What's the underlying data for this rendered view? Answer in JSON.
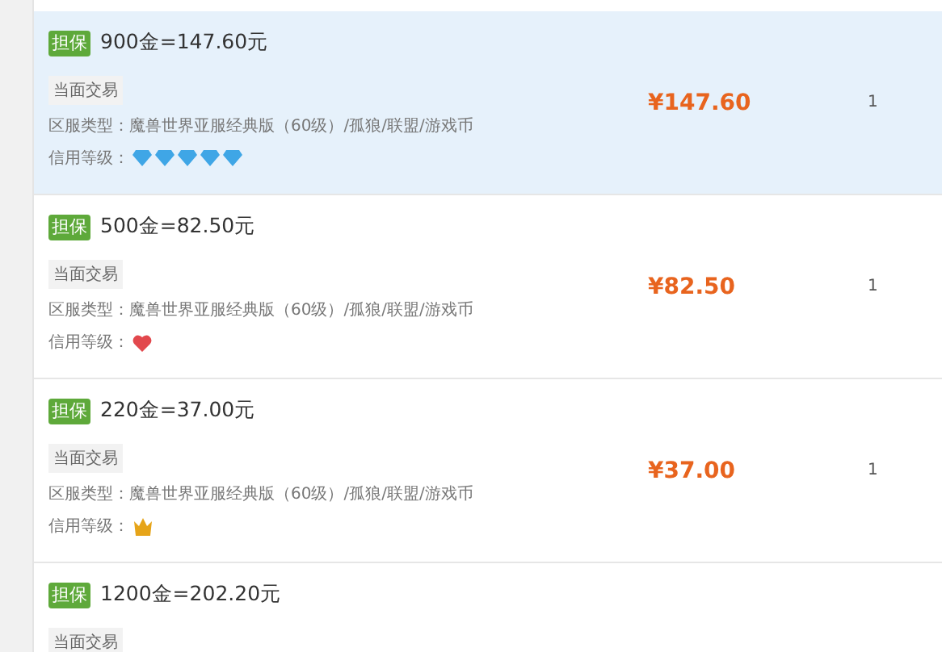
{
  "listings": [
    {
      "badge": "担保",
      "title": "900金=147.60元",
      "selected": true,
      "tag": "当面交易",
      "server": "区服类型：魔兽世界亚服经典版（60级）/孤狼/联盟/游戏币",
      "credit_label": "信用等级：",
      "credit_icons": [
        {
          "kind": "diamond"
        },
        {
          "kind": "diamond"
        },
        {
          "kind": "diamond"
        },
        {
          "kind": "diamond"
        },
        {
          "kind": "diamond"
        }
      ],
      "price": "¥147.60",
      "quantity": "1"
    },
    {
      "badge": "担保",
      "title": "500金=82.50元",
      "selected": false,
      "tag": "当面交易",
      "server": "区服类型：魔兽世界亚服经典版（60级）/孤狼/联盟/游戏币",
      "credit_label": "信用等级：",
      "credit_icons": [
        {
          "kind": "heart"
        }
      ],
      "price": "¥82.50",
      "quantity": "1"
    },
    {
      "badge": "担保",
      "title": "220金=37.00元",
      "selected": false,
      "tag": "当面交易",
      "server": "区服类型：魔兽世界亚服经典版（60级）/孤狼/联盟/游戏币",
      "credit_label": "信用等级：",
      "credit_icons": [
        {
          "kind": "crown"
        }
      ],
      "price": "¥37.00",
      "quantity": "1"
    },
    {
      "badge": "担保",
      "title": "1200金=202.20元",
      "selected": false,
      "tag": "当面交易"
    }
  ]
}
